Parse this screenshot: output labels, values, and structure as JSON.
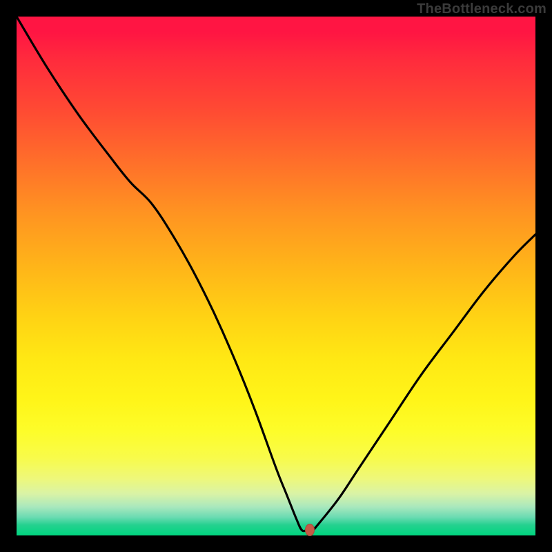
{
  "watermark": "TheBottleneck.com",
  "colors": {
    "frame": "#000000",
    "curve": "#000000",
    "marker": "#c55a46",
    "gradient_top": "#ff1543",
    "gradient_bottom": "#00d57f"
  },
  "chart_data": {
    "type": "line",
    "title": "",
    "xlabel": "",
    "ylabel": "",
    "xlim": [
      0,
      100
    ],
    "ylim": [
      0,
      100
    ],
    "grid": false,
    "series": [
      {
        "name": "bottleneck-curve",
        "x": [
          0,
          6,
          12,
          18,
          22,
          26,
          30,
          34,
          38,
          42,
          46,
          50,
          52,
          54,
          55,
          56,
          57,
          58,
          62,
          66,
          72,
          78,
          84,
          90,
          96,
          100
        ],
        "values": [
          100,
          90,
          81,
          73,
          68,
          64,
          58,
          51,
          43,
          34,
          24,
          13,
          8,
          3,
          1,
          1,
          1,
          2,
          7,
          13,
          22,
          31,
          39,
          47,
          54,
          58
        ]
      }
    ],
    "marker": {
      "x": 56.5,
      "y": 1
    },
    "legend": false
  }
}
